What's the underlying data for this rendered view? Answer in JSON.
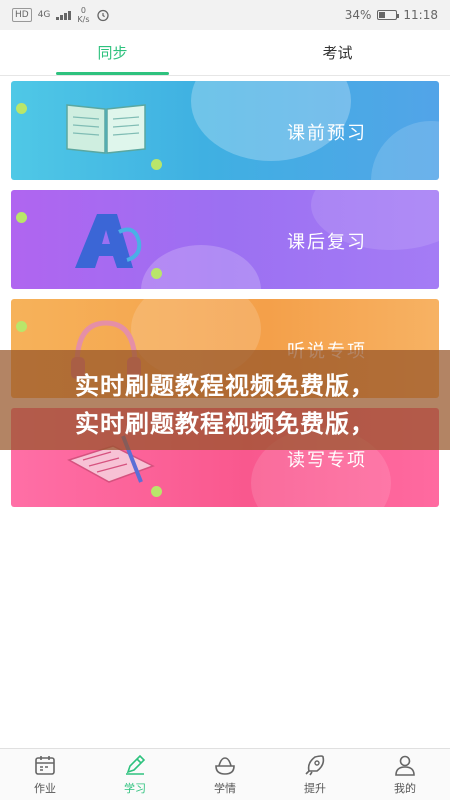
{
  "status_bar": {
    "hd": "HD",
    "network": "4G",
    "speed_value": "0",
    "speed_unit": "K/s",
    "battery": "34%",
    "battery_level": 0.34,
    "time": "11:18"
  },
  "tabs": [
    {
      "label": "同步",
      "active": true
    },
    {
      "label": "考试",
      "active": false
    }
  ],
  "cards": [
    {
      "label": "课前预习"
    },
    {
      "label": "课后复习"
    },
    {
      "label": "听说专项"
    },
    {
      "label": "读写专项"
    }
  ],
  "overlay": {
    "line1": "实时刷题教程视频免费版，",
    "line2": "实时刷题教程视频免费版，"
  },
  "bottom_nav": [
    {
      "label": "作业",
      "icon": "calendar-icon",
      "active": false
    },
    {
      "label": "学习",
      "icon": "pencil-icon",
      "active": true
    },
    {
      "label": "学情",
      "icon": "chart-bowl-icon",
      "active": false
    },
    {
      "label": "提升",
      "icon": "rocket-icon",
      "active": false
    },
    {
      "label": "我的",
      "icon": "user-icon",
      "active": false
    }
  ],
  "colors": {
    "accent": "#2ec27e",
    "preview_card": "#3fb0e2",
    "review_card": "#9c70f2",
    "listen_card": "#f4a04a",
    "read_card": "#f9588e"
  }
}
